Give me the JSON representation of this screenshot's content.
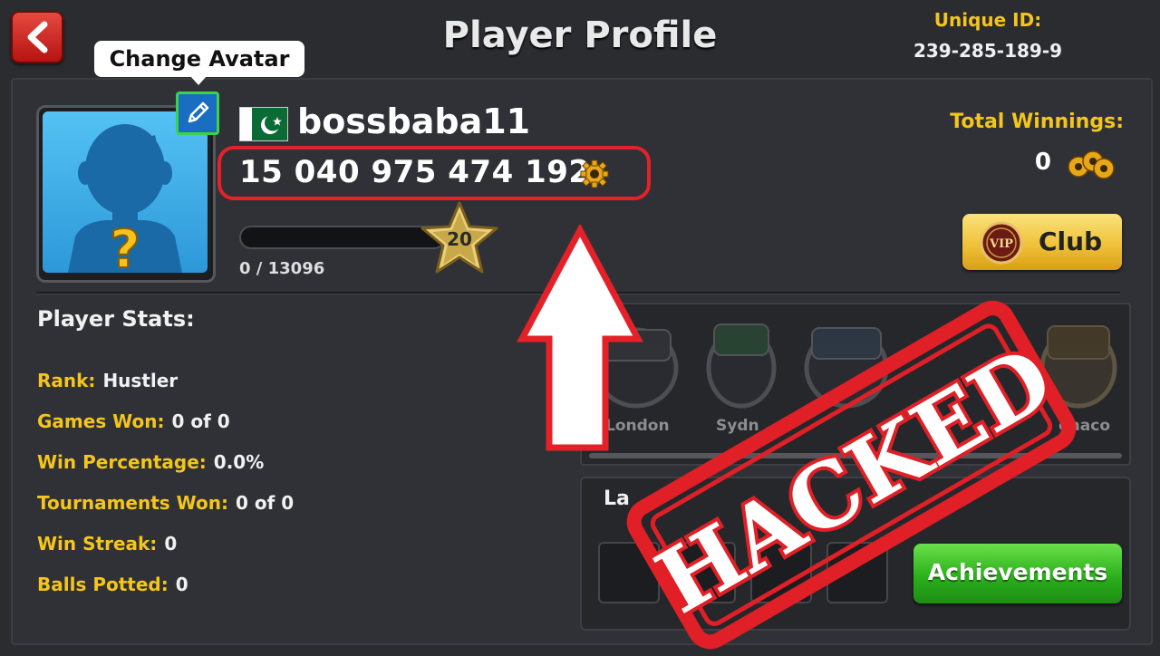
{
  "header": {
    "title": "Player Profile",
    "unique_id_label": "Unique ID:",
    "unique_id": "239-285-189-9"
  },
  "avatar": {
    "change_label": "Change Avatar"
  },
  "player": {
    "country_flag": "pakistan",
    "username": "bossbaba11",
    "coins": "15 040 975 474 192",
    "level": "20",
    "xp_text": "0 / 13096",
    "xp_progress_fraction": 0
  },
  "winnings": {
    "label": "Total Winnings:",
    "value": "0"
  },
  "club": {
    "badge": "VIP",
    "label": "Club"
  },
  "stats": {
    "title": "Player Stats:",
    "rows": [
      {
        "label": "Rank:",
        "value": "Hustler"
      },
      {
        "label": "Games Won:",
        "value": "0 of 0"
      },
      {
        "label": "Win Percentage:",
        "value": "0.0%"
      },
      {
        "label": "Tournaments Won:",
        "value": "0 of 0"
      },
      {
        "label": "Win Streak:",
        "value": "0"
      },
      {
        "label": "Balls Potted:",
        "value": "0"
      }
    ]
  },
  "rings": {
    "labels": [
      "London",
      "Sydn",
      "onaco"
    ]
  },
  "latest": {
    "title": "La"
  },
  "achievements": {
    "label": "Achievements"
  },
  "stamp": {
    "text": "HACKED"
  },
  "colors": {
    "gold": "#f4c51c",
    "highlight_red": "#e42128",
    "achievement_green": "#2bb01c"
  }
}
